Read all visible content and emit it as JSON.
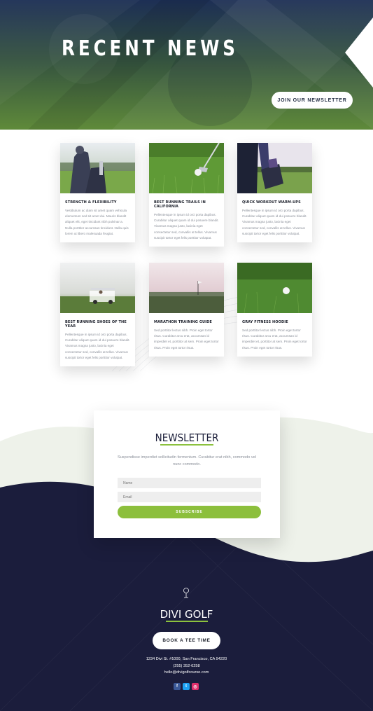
{
  "hero": {
    "title": "RECENT NEWS",
    "join_button": "JOIN OUR NEWSLETTER"
  },
  "posts": [
    {
      "title": "STRENGTH & FLEXIBILITY",
      "excerpt": "Vestibulum ac diam sit amet quam vehicula elementum sed sit amet dui. Mauris blandit aliquet elit, eget tincidunt nibh pulvinar a. Nulla porttitor accumsan tincidunt. Nulla quis lorem ut libero malesuada feugiat.",
      "image": "golf-bag-on-course"
    },
    {
      "title": "BEST RUNNING TRAILS IN CALIFORNIA",
      "excerpt": "Pellentesque in ipsum id orci porta dapibus. Curabitur aliquet quam id dui posuere blandit. Vivamus magna justo, lacinia eget consectetur sed, convallis at tellus. Vivamus suscipit tortor eget felis porttitor volutpat.",
      "image": "golf-ball-and-club-on-grass"
    },
    {
      "title": "QUICK WORKOUT WARM-UPS",
      "excerpt": "Pellentesque in ipsum id orci porta dapibus. Curabitur aliquet quam id dui posuere blandit. Vivamus magna justo, lacinia eget consectetur sed, convallis at tellus. Vivamus suscipit tortor eget felis porttitor volutpat.",
      "image": "golfer-holding-bag"
    },
    {
      "title": "BEST RUNNING SHOES OF THE YEAR",
      "excerpt": "Pellentesque in ipsum id orci porta dapibus. Curabitur aliquet quam id dui posuere blandit. Vivamus magna justo, lacinia eget consectetur sed, convallis at tellus. Vivamus suscipit tortor eget felis porttitor volutpat.",
      "image": "golf-cart-on-fairway"
    },
    {
      "title": "MARATHON TRAINING GUIDE",
      "excerpt": "Sed porttitor lectus nibh. Proin eget tortor risus. Curabitur arcu erat, accumsan id imperdiet et, porttitor at sem. Proin eget tortor risus. Proin eget tortor risus.",
      "image": "golf-green-at-sunset"
    },
    {
      "title": "GRAY FITNESS HOODIE",
      "excerpt": "Sed porttitor lectus nibh. Proin eget tortor risus. Curabitur arcu erat, accumsan id imperdiet et, porttitor at sem. Proin eget tortor risus. Proin eget tortor risus.",
      "image": "golf-ball-in-grass"
    }
  ],
  "newsletter": {
    "title": "NEWSLETTER",
    "description": "Suspendisse imperdiet sollicitudin fermentum. Curabitur erat nibh, commodo vel nunc commodo.",
    "name_placeholder": "Name",
    "email_placeholder": "Email",
    "submit_label": "SUBSCRIBE"
  },
  "footer": {
    "icon": "golf-pin-icon",
    "brand": "DIVI GOLF",
    "tee_button": "BOOK A TEE TIME",
    "address": "1234 Divi St. #1000, San Francisco, CA 94220",
    "phone": "(255) 352-6258",
    "email": "hello@divigolfcourse.com",
    "social": [
      {
        "icon": "facebook-icon",
        "glyph": "f",
        "color": "#3b5998"
      },
      {
        "icon": "twitter-icon",
        "glyph": "t",
        "color": "#1da1f2"
      },
      {
        "icon": "instagram-icon",
        "glyph": "◎",
        "color": "#e1306c"
      }
    ]
  },
  "colors": {
    "accent": "#8cc13e",
    "navy": "#1b1d3c",
    "hero_green": "#5f8a3a"
  }
}
